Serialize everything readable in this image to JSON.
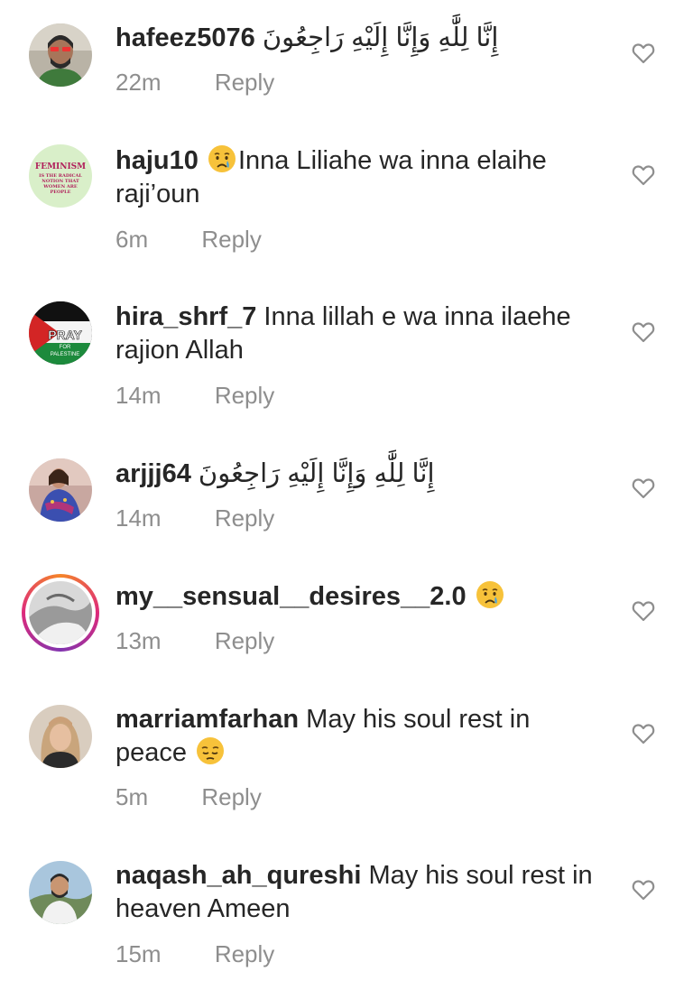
{
  "comments": [
    {
      "username": "hafeez5076",
      "text": "إِنَّا لِلَّٰهِ وَإِنَّا إِلَيْهِ رَاجِعُونَ",
      "emoji": "",
      "text_after": "",
      "time": "22m",
      "reply": "Reply"
    },
    {
      "username": "haju10",
      "emoji": "crying-face",
      "text": "Inna Liliahe wa inna elaihe raji’oun",
      "text_after": "",
      "time": "6m",
      "reply": "Reply",
      "avatar_text": [
        "FEMINISM",
        "IS THE RADICAL",
        "NOTION THAT",
        "WOMEN ARE",
        "PEOPLE"
      ]
    },
    {
      "username": "hira_shrf_7",
      "emoji": "",
      "text": "Inna lillah e wa inna ilaehe rajion Allah",
      "text_after": "",
      "time": "14m",
      "reply": "Reply",
      "avatar_text": [
        "PRAY",
        "FOR",
        "PALESTINE"
      ]
    },
    {
      "username": "arjjj64",
      "text": "إِنَّا لِلَّٰهِ وَإِنَّا إِلَيْهِ رَاجِعُونَ",
      "emoji": "",
      "text_after": "",
      "time": "14m",
      "reply": "Reply"
    },
    {
      "username": "my__sensual__desires__2.0",
      "text": "",
      "emoji": "crying-face",
      "text_after": "",
      "time": "13m",
      "reply": "Reply"
    },
    {
      "username": "marriamfarhan",
      "text": "May his soul rest in peace",
      "emoji": "pensive-face",
      "text_after": "",
      "time": "5m",
      "reply": "Reply"
    },
    {
      "username": "naqash_ah_qureshi",
      "text": "May his soul rest in heaven Ameen",
      "emoji": "",
      "text_after": "",
      "time": "15m",
      "reply": "Reply"
    }
  ],
  "colors": {
    "text": "#262626",
    "muted": "#8e8e8e",
    "emoji_yellow": "#f7c23a",
    "tear_blue": "#4aa3df"
  }
}
